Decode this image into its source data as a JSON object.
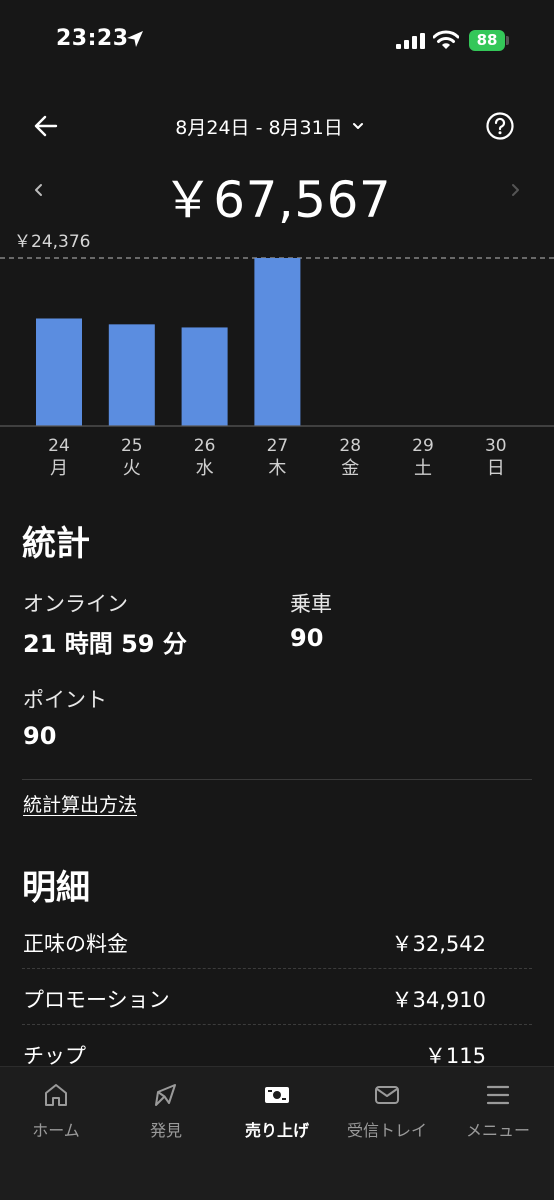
{
  "status": {
    "time": "23:23",
    "battery": "88"
  },
  "header": {
    "date_range": "8月24日 - 8月31日",
    "total": "￥67,567"
  },
  "chart_data": {
    "type": "bar",
    "categories": [
      "24",
      "25",
      "26",
      "27",
      "28",
      "29",
      "30"
    ],
    "weekdays": [
      "月",
      "火",
      "水",
      "木",
      "金",
      "土",
      "日"
    ],
    "values": [
      15600,
      14750,
      14300,
      24376,
      0,
      0,
      0
    ],
    "max_label": "￥24,376",
    "ylim": [
      0,
      24376
    ],
    "bar_color": "#5b8de0"
  },
  "stats": {
    "title": "統計",
    "online_label": "オンライン",
    "online_value": "21 時間 59 分",
    "rides_label": "乗車",
    "rides_value": "90",
    "points_label": "ポイント",
    "points_value": "90",
    "method_link": "統計算出方法"
  },
  "details": {
    "title": "明細",
    "rows": [
      {
        "label": "正味の料金",
        "value": "￥32,542"
      },
      {
        "label": "プロモーション",
        "value": "￥34,910"
      },
      {
        "label": "チップ",
        "value": "￥115"
      }
    ]
  },
  "nav": {
    "items": [
      {
        "label": "ホーム",
        "icon": "home-icon"
      },
      {
        "label": "発見",
        "icon": "compass-icon"
      },
      {
        "label": "売り上げ",
        "icon": "earnings-icon"
      },
      {
        "label": "受信トレイ",
        "icon": "mail-icon"
      },
      {
        "label": "メニュー",
        "icon": "menu-icon"
      }
    ]
  }
}
